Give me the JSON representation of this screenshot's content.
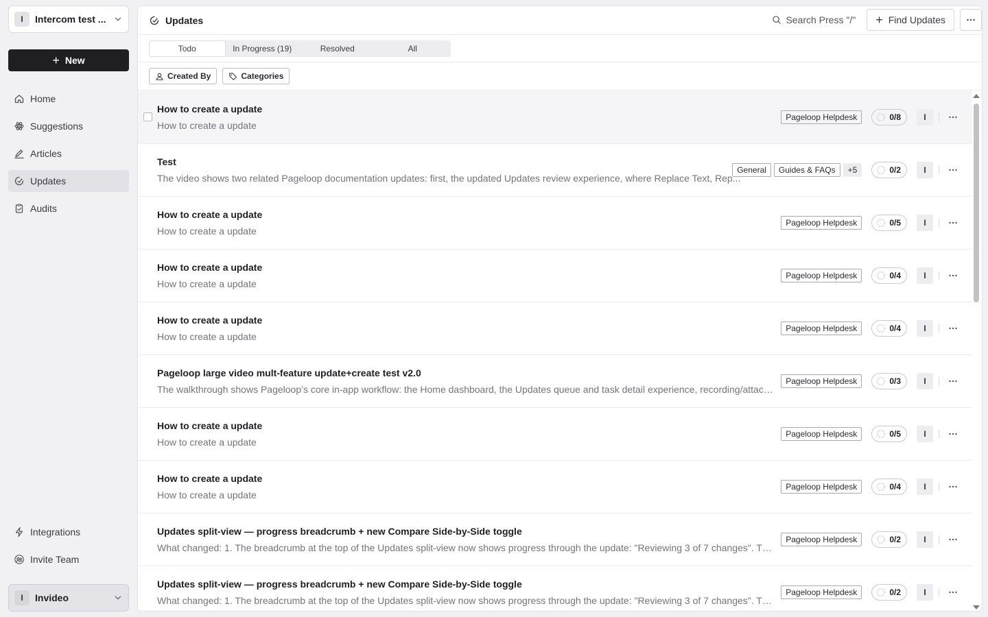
{
  "sidebar": {
    "workspace": {
      "avatar": "I",
      "name": "Intercom test ..."
    },
    "new_label": "New",
    "nav": [
      {
        "label": "Home",
        "icon": "home-icon"
      },
      {
        "label": "Suggestions",
        "icon": "atom-icon"
      },
      {
        "label": "Articles",
        "icon": "pen-icon"
      },
      {
        "label": "Updates",
        "icon": "updates-icon",
        "active": true
      },
      {
        "label": "Audits",
        "icon": "clipboard-icon"
      }
    ],
    "bottom_nav": [
      {
        "label": "Integrations",
        "icon": "lightning-icon"
      },
      {
        "label": "Invite Team",
        "icon": "users-icon"
      }
    ],
    "org": {
      "avatar": "I",
      "name": "Invideo"
    }
  },
  "header": {
    "title": "Updates",
    "search_label": "Search Press \"/\"",
    "find_label": "Find Updates"
  },
  "tabs": [
    {
      "label": "Todo",
      "active": true
    },
    {
      "label": "In Progress (19)",
      "active": false
    },
    {
      "label": "Resolved",
      "active": false
    },
    {
      "label": "All",
      "active": false
    }
  ],
  "filters": [
    {
      "label": "Created By",
      "icon": "user-icon"
    },
    {
      "label": "Categories",
      "icon": "tag-icon"
    }
  ],
  "rows": [
    {
      "title": "How to create a update",
      "desc": "How to create a update",
      "tags": [
        "Pageloop Helpdesk"
      ],
      "progress": "0/8",
      "assignee": "I"
    },
    {
      "title": "Test",
      "desc": "The video shows two related Pageloop documentation updates: first, the updated Updates review experience, where Replace Text, Rep...",
      "tags": [
        "General",
        "Guides & FAQs"
      ],
      "more": "+5",
      "progress": "0/2",
      "assignee": "I"
    },
    {
      "title": "How to create a update",
      "desc": "How to create a update",
      "tags": [
        "Pageloop Helpdesk"
      ],
      "progress": "0/5",
      "assignee": "I"
    },
    {
      "title": "How to create a update",
      "desc": "How to create a update",
      "tags": [
        "Pageloop Helpdesk"
      ],
      "progress": "0/4",
      "assignee": "I"
    },
    {
      "title": "How to create a update",
      "desc": "How to create a update",
      "tags": [
        "Pageloop Helpdesk"
      ],
      "progress": "0/4",
      "assignee": "I"
    },
    {
      "title": "Pageloop large video mult-feature update+create test v2.0",
      "desc": "The walkthrough shows Pageloop’s core in-app workflow: the Home dashboard, the Updates queue and task detail experience, recording/attach...",
      "tags": [
        "Pageloop Helpdesk"
      ],
      "progress": "0/3",
      "assignee": "I"
    },
    {
      "title": "How to create a update",
      "desc": "How to create a update",
      "tags": [
        "Pageloop Helpdesk"
      ],
      "progress": "0/5",
      "assignee": "I"
    },
    {
      "title": "How to create a update",
      "desc": "How to create a update",
      "tags": [
        "Pageloop Helpdesk"
      ],
      "progress": "0/4",
      "assignee": "I"
    },
    {
      "title": "Updates split-view — progress breadcrumb + new Compare Side-by-Side toggle",
      "desc": "What changed: 1. The breadcrumb at the top of the Updates split-view now shows progress through the update: \"Reviewing 3 of 7 changes\". The...",
      "tags": [
        "Pageloop Helpdesk"
      ],
      "progress": "0/2",
      "assignee": "I"
    },
    {
      "title": "Updates split-view — progress breadcrumb + new Compare Side-by-Side toggle",
      "desc": "What changed: 1. The breadcrumb at the top of the Updates split-view now shows progress through the update: \"Reviewing 3 of 7 changes\". The...",
      "tags": [
        "Pageloop Helpdesk"
      ],
      "progress": "0/2",
      "assignee": "I"
    }
  ]
}
